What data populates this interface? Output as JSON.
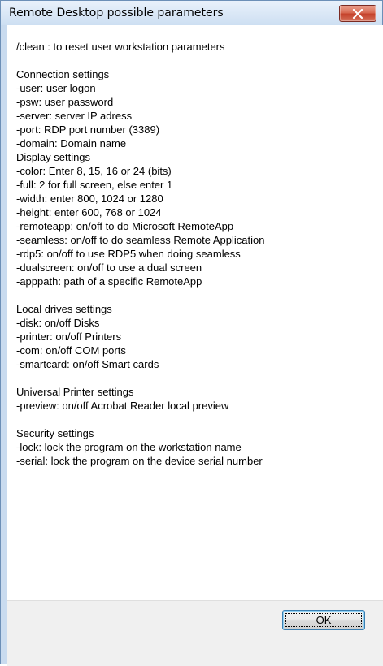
{
  "window": {
    "title": "Remote Desktop possible parameters",
    "close_icon": "close-x-icon"
  },
  "content": {
    "lines": [
      "",
      "/clean : to reset user workstation parameters",
      "",
      "Connection settings",
      " -user: user logon",
      " -psw: user password",
      " -server: server IP adress",
      " -port: RDP port number (3389)",
      " -domain: Domain name",
      "Display settings",
      " -color: Enter 8, 15, 16 or 24 (bits)",
      " -full: 2 for full screen, else enter 1",
      " -width: enter 800, 1024 or 1280",
      " -height: enter 600, 768 or 1024",
      " -remoteapp: on/off to do Microsoft RemoteApp",
      " -seamless: on/off to do seamless Remote Application",
      " -rdp5: on/off to use RDP5 when doing seamless",
      " -dualscreen: on/off to use a dual screen",
      " -apppath: path of a specific RemoteApp",
      "",
      "Local drives settings",
      " -disk: on/off Disks",
      " -printer: on/off Printers",
      " -com: on/off COM ports",
      " -smartcard: on/off Smart cards",
      "",
      "Universal Printer settings",
      " -preview: on/off Acrobat Reader local preview",
      "",
      "Security settings",
      " -lock: lock the program on the workstation name",
      " -serial: lock the program on the device serial number"
    ]
  },
  "footer": {
    "ok_label": "OK"
  },
  "colors": {
    "close_red": "#c4412a",
    "frame": "#c9dbef",
    "button_border": "#3c7fb1"
  }
}
